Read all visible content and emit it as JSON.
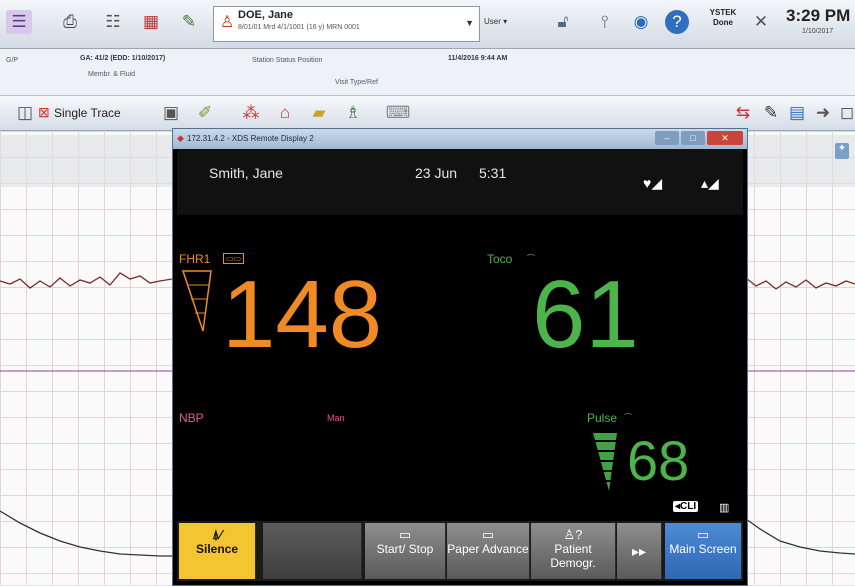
{
  "toolbar": {
    "icons": [
      "pregnancy-icon",
      "print-icon",
      "list-icon",
      "grid-icon",
      "tools-icon"
    ],
    "patient": {
      "name": "DOE, Jane",
      "meta": "8/01/01    Mrd 4/1/1001 (16 y)    MRN 0001"
    },
    "user_label": "User",
    "done_label": "YSTEK Done",
    "time": "3:29 PM",
    "date": "1/10/2017"
  },
  "info_strip": {
    "ga": "GA: 41/2 (EDD: 1/10/2017)",
    "gp": "G/P",
    "membrane": "Membr. & Fluid",
    "station": "Station Status Position",
    "visit": "Visit Type/Ref",
    "admit": "11/4/2016 9:44 AM"
  },
  "toolbar2": {
    "single_trace": "Single Trace"
  },
  "remote": {
    "title": "172.31.4.2 - XDS Remote Display 2",
    "patient_name": "Smith, Jane",
    "date": "23 Jun",
    "time": "5:31",
    "fhr1_label": "FHR1",
    "fhr1_value": "148",
    "toco_label": "Toco",
    "toco_value": "61",
    "nbp_label": "NBP",
    "nbp_mode": "Man",
    "pulse_label": "Pulse",
    "pulse_value": "68",
    "softkeys": {
      "silence": "Silence",
      "start_stop": "Start/ Stop",
      "paper_advance": "Paper Advance",
      "patient_demogr": "Patient Demogr.",
      "main_screen": "Main Screen"
    }
  },
  "colors": {
    "fhr": "#f08a24",
    "toco": "#4cb44a",
    "nbp": "#e05a8a",
    "silence_key": "#f2c531",
    "main_key": "#3a76c4"
  }
}
